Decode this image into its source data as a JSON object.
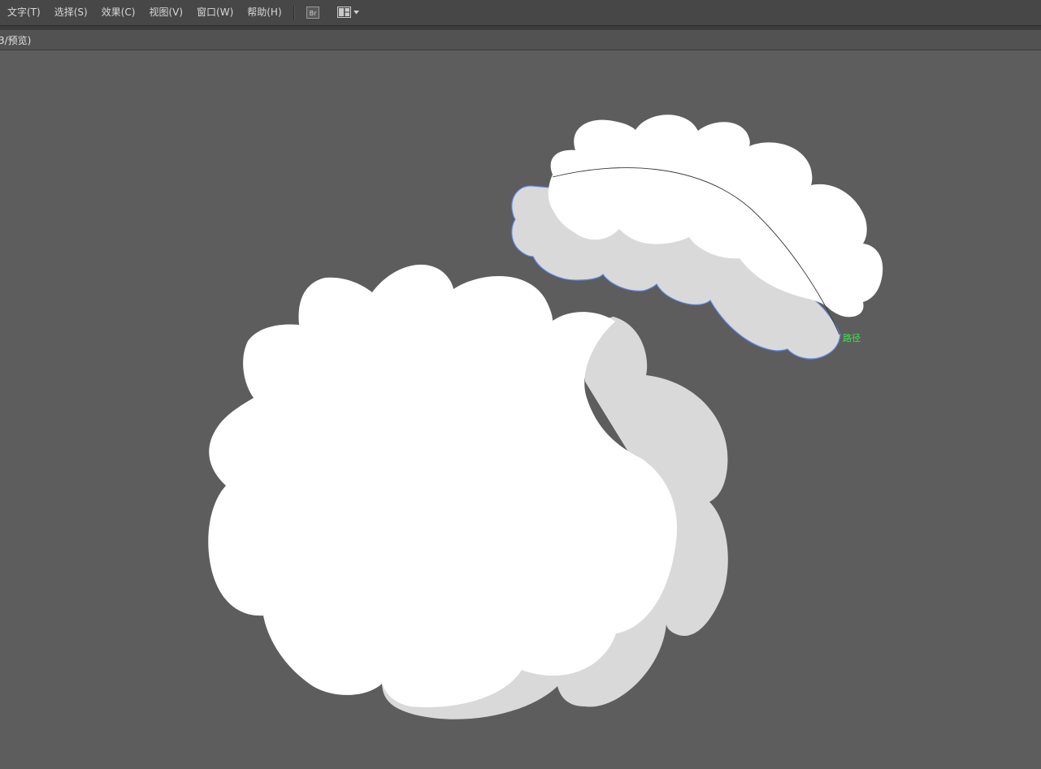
{
  "menubar": {
    "items": [
      {
        "label": "文字(T)"
      },
      {
        "label": "选择(S)"
      },
      {
        "label": "效果(C)"
      },
      {
        "label": "视图(V)"
      },
      {
        "label": "窗口(W)"
      },
      {
        "label": "帮助(H)"
      }
    ],
    "bridge_icon": "br-icon",
    "layout_icon": "arrange-documents-icon"
  },
  "document": {
    "tab_label": "3/预览)"
  },
  "canvas": {
    "smart_guide_label": "路径",
    "colors": {
      "background": "#5d5d5d",
      "cloud_white": "#ffffff",
      "cloud_shadow": "#d9d9d9",
      "selection": "#5b86e0",
      "smart_guide": "#39e64a"
    }
  }
}
